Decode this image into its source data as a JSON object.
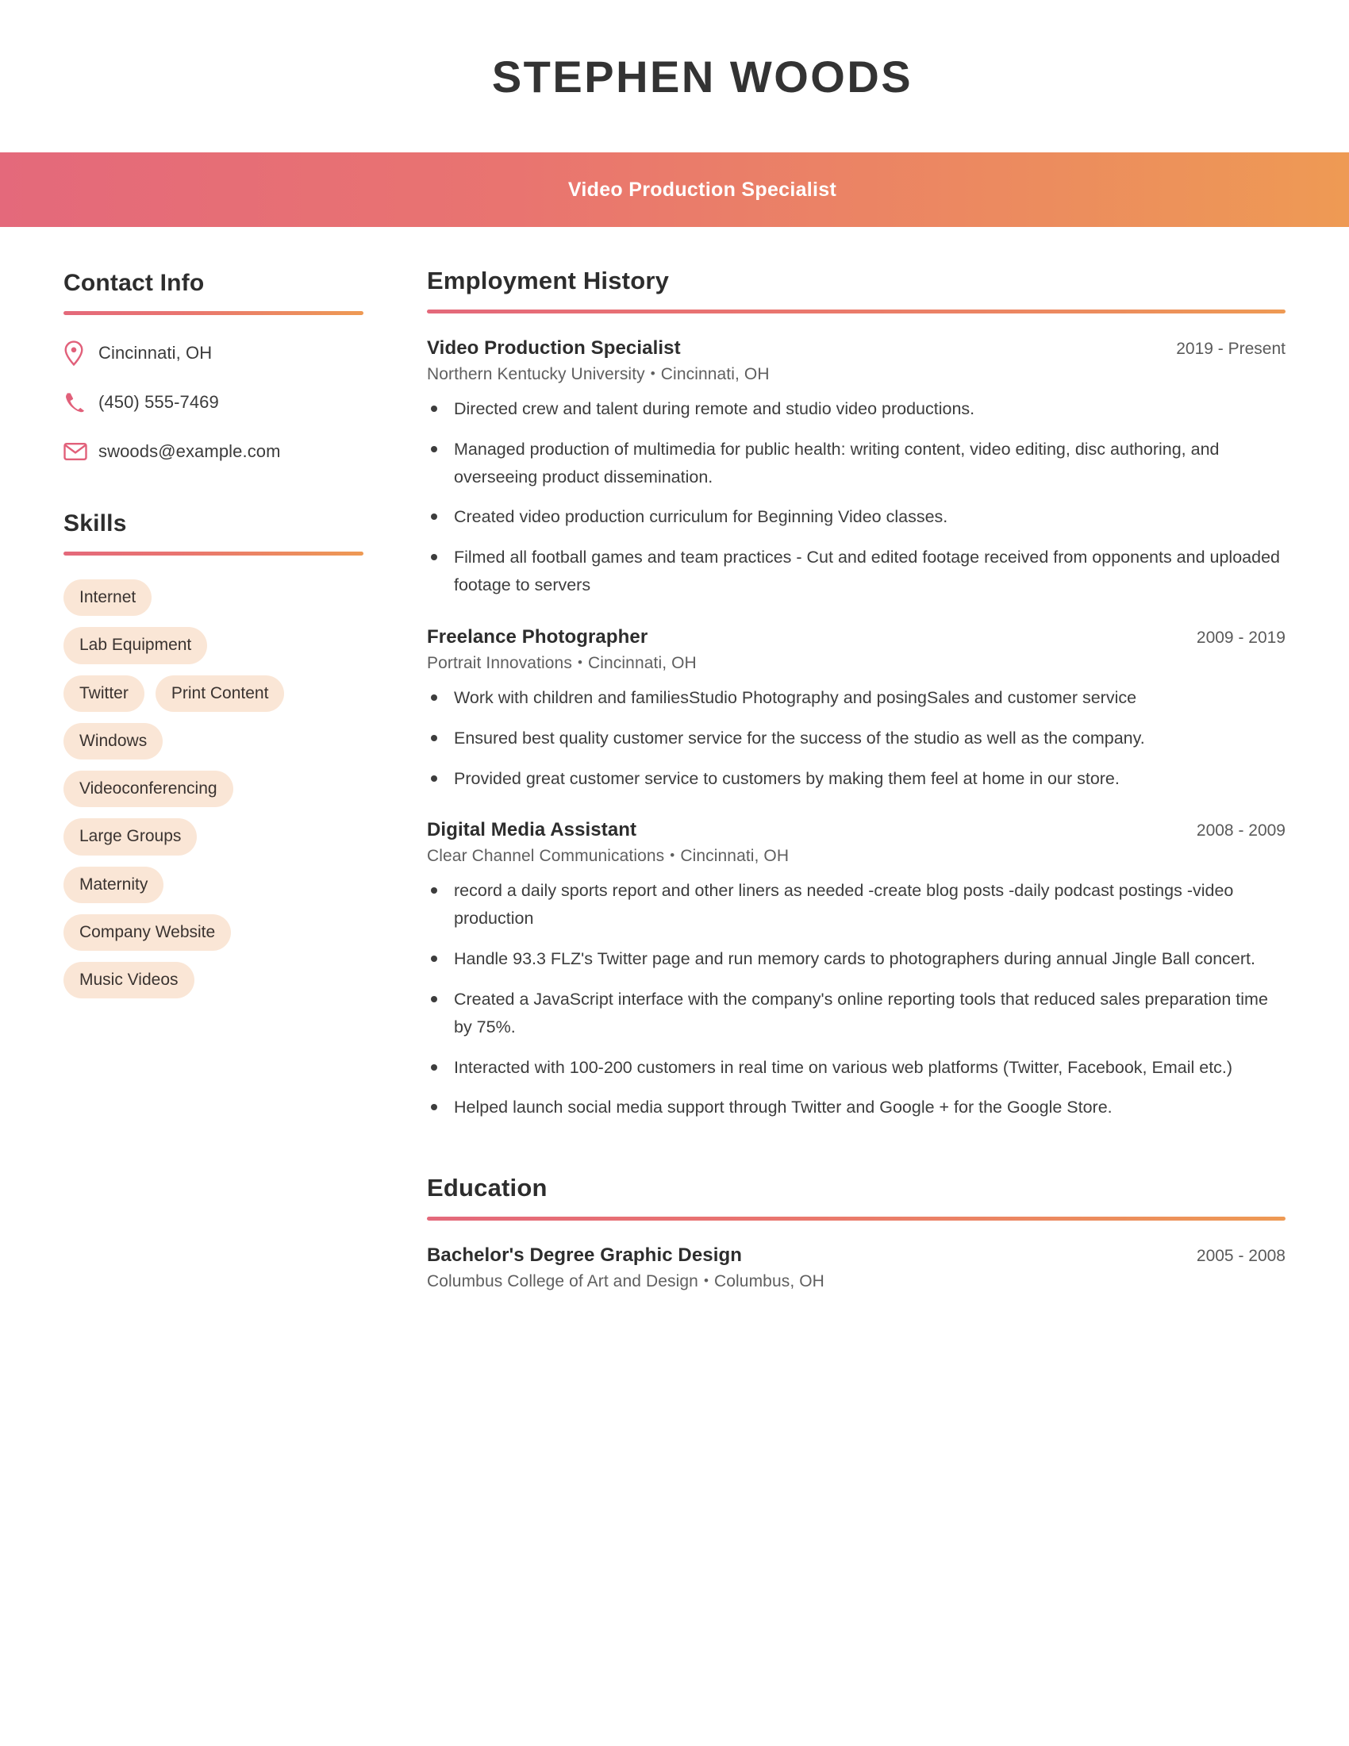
{
  "header": {
    "name": "STEPHEN WOODS",
    "title": "Video Production Specialist",
    "gradient_start": "#e4697b",
    "gradient_end": "#ee9a54"
  },
  "sidebar": {
    "contact": {
      "heading": "Contact Info",
      "items": [
        {
          "icon": "location-pin-icon",
          "value": "Cincinnati, OH"
        },
        {
          "icon": "phone-icon",
          "value": "(450) 555-7469"
        },
        {
          "icon": "envelope-icon",
          "value": "swoods@example.com"
        }
      ]
    },
    "skills": {
      "heading": "Skills",
      "pill_bg": "#fae6d6",
      "rows": [
        [
          "Internet"
        ],
        [
          "Lab Equipment"
        ],
        [
          "Twitter",
          "Print Content"
        ],
        [
          "Windows"
        ],
        [
          "Videoconferencing"
        ],
        [
          "Large Groups"
        ],
        [
          "Maternity"
        ],
        [
          "Company Website"
        ],
        [
          "Music Videos"
        ]
      ]
    }
  },
  "main": {
    "employment": {
      "heading": "Employment History",
      "jobs": [
        {
          "title": "Video Production Specialist",
          "dates": "2019 - Present",
          "company": "Northern Kentucky University",
          "location": "Cincinnati, OH",
          "bullets": [
            "Directed crew and talent during remote and studio video productions.",
            "Managed production of multimedia for public health: writing content, video editing, disc authoring, and overseeing product dissemination.",
            "Created video production curriculum for Beginning Video classes.",
            "Filmed all football games and team practices - Cut and edited footage received from opponents and uploaded footage to servers"
          ]
        },
        {
          "title": "Freelance Photographer",
          "dates": "2009 - 2019",
          "company": "Portrait Innovations",
          "location": "Cincinnati, OH",
          "bullets": [
            "Work with children and familiesStudio Photography and posingSales and customer service",
            "Ensured best quality customer service for the success of the studio as well as the company.",
            "Provided great customer service to customers by making them feel at home in our store."
          ]
        },
        {
          "title": "Digital Media Assistant",
          "dates": "2008 - 2009",
          "company": "Clear Channel Communications",
          "location": "Cincinnati, OH",
          "bullets": [
            "record a daily sports report and other liners as needed -create blog posts -daily podcast postings -video production",
            "Handle 93.3 FLZ's Twitter page and run memory cards to photographers during annual Jingle Ball concert.",
            "Created a JavaScript interface with the company's online reporting tools that reduced sales preparation time by 75%.",
            "Interacted with 100-200 customers in real time on various web platforms (Twitter, Facebook, Email etc.)",
            "Helped launch social media support through Twitter and Google + for the Google Store."
          ]
        }
      ]
    },
    "education": {
      "heading": "Education",
      "items": [
        {
          "degree": "Bachelor's Degree Graphic Design",
          "dates": "2005 - 2008",
          "school": "Columbus College of Art and Design",
          "location": "Columbus, OH"
        }
      ]
    }
  },
  "separator": "•"
}
